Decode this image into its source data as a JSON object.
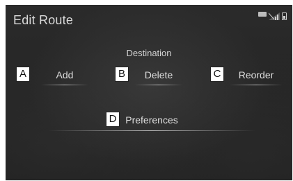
{
  "screen": {
    "title": "Edit Route",
    "section_label": "Destination",
    "buttons": {
      "add": "Add",
      "delete": "Delete",
      "reorder": "Reorder",
      "preferences": "Preferences"
    },
    "status_icons": [
      "bluetooth-icon",
      "signal-strength-icon",
      "battery-icon"
    ]
  },
  "callouts": {
    "a": "A",
    "b": "B",
    "c": "C",
    "d": "D"
  }
}
